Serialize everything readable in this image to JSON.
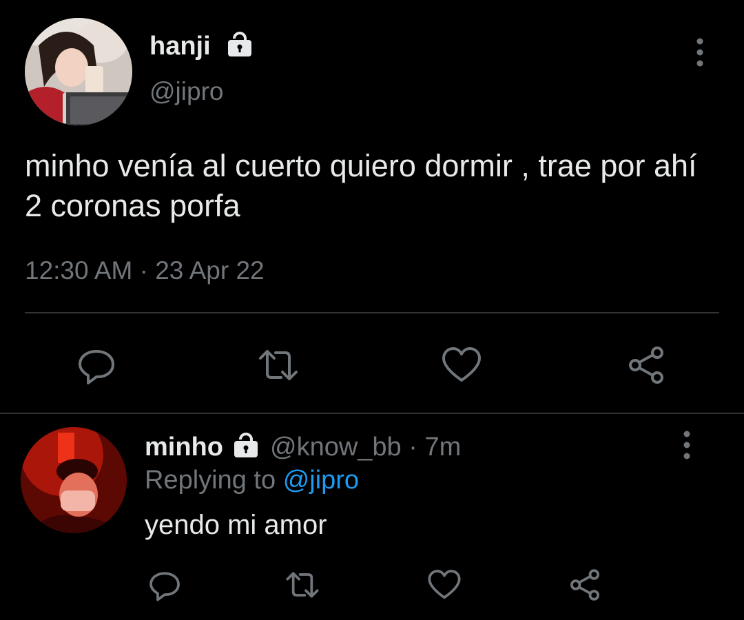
{
  "main_tweet": {
    "author": {
      "display_name": "hanji",
      "handle": "@jipro",
      "protected_icon": "lock-icon",
      "avatar": "profile-photo"
    },
    "text": "minho venía al cuerto quiero dormir , trae por ahí 2 coronas porfa",
    "timestamp": "12:30 AM · 23 Apr 22",
    "menu_icon": "more-vertical-icon",
    "actions": [
      "reply-icon",
      "retweet-icon",
      "like-icon",
      "share-icon"
    ]
  },
  "reply_tweet": {
    "author": {
      "display_name": "minho",
      "handle": "@know_bb",
      "protected_icon": "lock-icon",
      "avatar": "profile-photo"
    },
    "meta": "@know_bb · 7m",
    "replying_prefix": "Replying to",
    "replying_mention": "@jipro",
    "text": "yendo mi amor",
    "menu_icon": "more-vertical-icon",
    "actions": [
      "reply-icon",
      "retweet-icon",
      "like-icon",
      "share-icon"
    ]
  },
  "colors": {
    "background": "#000000",
    "primary_text": "#e7e9ea",
    "secondary_text": "#71767b",
    "link": "#1d9bf0",
    "divider": "#2f3336"
  }
}
